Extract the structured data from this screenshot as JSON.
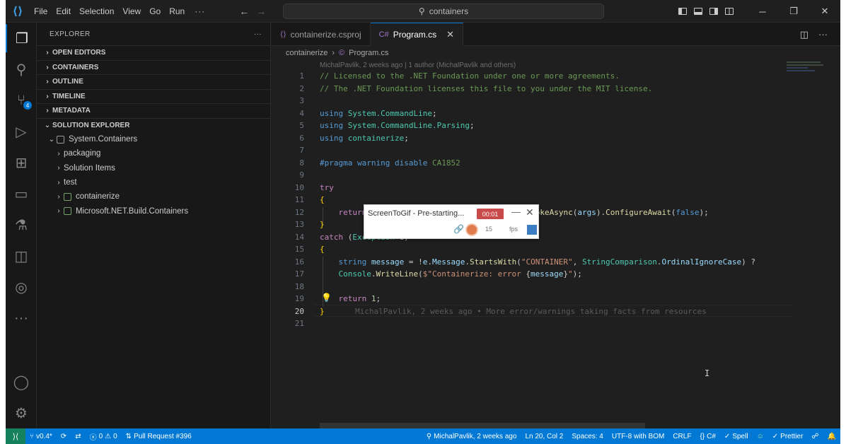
{
  "menu": [
    "File",
    "Edit",
    "Selection",
    "View",
    "Go",
    "Run"
  ],
  "menu_more": "···",
  "command_center": {
    "search_text": "containers"
  },
  "sidebar": {
    "title": "EXPLORER",
    "more": "···",
    "sections": [
      "OPEN EDITORS",
      "CONTAINERS",
      "OUTLINE",
      "TIMELINE",
      "METADATA",
      "SOLUTION EXPLORER"
    ],
    "tree": [
      {
        "label": "System.Containers",
        "level": 1,
        "expanded": true,
        "icon": "solution-icon"
      },
      {
        "label": "packaging",
        "level": 2,
        "expanded": false
      },
      {
        "label": "Solution Items",
        "level": 2,
        "expanded": false
      },
      {
        "label": "test",
        "level": 2,
        "expanded": false
      },
      {
        "label": "containerize",
        "level": 2,
        "expanded": false,
        "icon": "csharp-project-icon"
      },
      {
        "label": "Microsoft.NET.Build.Containers",
        "level": 2,
        "expanded": false,
        "icon": "csharp-project-icon"
      }
    ]
  },
  "activity_bar": {
    "items": [
      "explorer-icon",
      "search-icon",
      "source-control-icon",
      "run-debug-icon",
      "extensions-icon",
      "remote-explorer-icon",
      "testing-icon",
      "containers-icon",
      "timeline-icon",
      "more-icon",
      "accounts-icon",
      "settings-icon"
    ],
    "source_control_badge": "4"
  },
  "tabs": [
    {
      "label": "containerize.csproj",
      "active": false
    },
    {
      "label": "Program.cs",
      "active": true
    }
  ],
  "breadcrumb": [
    "containerize",
    "Program.cs"
  ],
  "editor": {
    "blame_header": "MichalPavlik, 2 weeks ago | 1 author (MichalPavlik and others)",
    "line_numbers": [
      "1",
      "2",
      "3",
      "4",
      "5",
      "6",
      "7",
      "8",
      "9",
      "10",
      "11",
      "12",
      "13",
      "14",
      "15",
      "16",
      "17",
      "18",
      "19",
      "20",
      "21"
    ],
    "current_line": "20",
    "inline_blame": "MichalPavlik, 2 weeks ago • More error/warnings taking facts from resources"
  },
  "popup": {
    "title": "ScreenToGif - Pre-starting...",
    "timer": "00:01",
    "fps": "15",
    "fps_unit": "fps"
  },
  "statusbar": {
    "branch": "v0.4*",
    "sync": "",
    "errors": "0",
    "warnings": "0",
    "pull_request": "Pull Request #396",
    "blame": "MichalPavlik, 2 weeks ago",
    "position": "Ln 20, Col 2",
    "spaces": "Spaces: 4",
    "encoding": "UTF-8 with BOM",
    "eol": "CRLF",
    "language": "C#",
    "spell": "Spell",
    "prettier": "Prettier"
  },
  "colors": {
    "accent": "#0078d4",
    "remote_indicator": "#16825d",
    "popup_badge": "#c94a4a"
  }
}
